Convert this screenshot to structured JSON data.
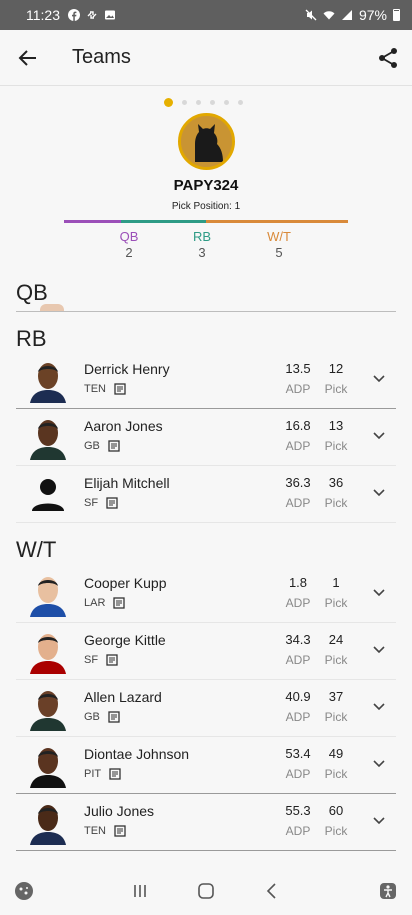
{
  "status_bar": {
    "time": "11:23",
    "battery": "97%",
    "icons_left": [
      "facebook-icon",
      "link-icon",
      "image-icon"
    ],
    "icons_right": [
      "mute-icon",
      "wifi-icon",
      "signal-icon",
      "battery-icon"
    ]
  },
  "appbar": {
    "title": "Teams"
  },
  "team": {
    "name": "PAPY324",
    "pick_position": "Pick Position: 1",
    "carousel_pages": 6,
    "active_page": 0
  },
  "position_summary": [
    {
      "label": "QB",
      "count": "2",
      "color": "#9b4fb8",
      "share": 0.2
    },
    {
      "label": "RB",
      "count": "3",
      "color": "#2e9b86",
      "share": 0.3
    },
    {
      "label": "W/T",
      "count": "5",
      "color": "#d98a3a",
      "share": 0.5
    }
  ],
  "sections": {
    "qb": "QB",
    "rb": "RB",
    "wt": "W/T"
  },
  "stat_labels": {
    "adp": "ADP",
    "pick": "Pick"
  },
  "rb_players": [
    {
      "name": "Derrick Henry",
      "team": "TEN",
      "adp": "13.5",
      "pick": "12",
      "skin": "#6b4226",
      "jersey": "#1d2d52",
      "has_photo": true
    },
    {
      "name": "Aaron Jones",
      "team": "GB",
      "adp": "16.8",
      "pick": "13",
      "skin": "#5a3520",
      "jersey": "#203731",
      "has_photo": true
    },
    {
      "name": "Elijah Mitchell",
      "team": "SF",
      "adp": "36.3",
      "pick": "36",
      "skin": "",
      "jersey": "",
      "has_photo": false
    }
  ],
  "wt_players": [
    {
      "name": "Cooper Kupp",
      "team": "LAR",
      "adp": "1.8",
      "pick": "1",
      "skin": "#e8c0a0",
      "jersey": "#1e4fa8",
      "has_photo": true
    },
    {
      "name": "George Kittle",
      "team": "SF",
      "adp": "34.3",
      "pick": "24",
      "skin": "#e3b08d",
      "jersey": "#aa0000",
      "has_photo": true
    },
    {
      "name": "Allen Lazard",
      "team": "GB",
      "adp": "40.9",
      "pick": "37",
      "skin": "#6a4028",
      "jersey": "#203731",
      "has_photo": true
    },
    {
      "name": "Diontae Johnson",
      "team": "PIT",
      "adp": "53.4",
      "pick": "49",
      "skin": "#5a3420",
      "jersey": "#111111",
      "has_photo": true
    },
    {
      "name": "Julio Jones",
      "team": "TEN",
      "adp": "55.3",
      "pick": "60",
      "skin": "#4a2a18",
      "jersey": "#1d2d52",
      "has_photo": true
    }
  ]
}
